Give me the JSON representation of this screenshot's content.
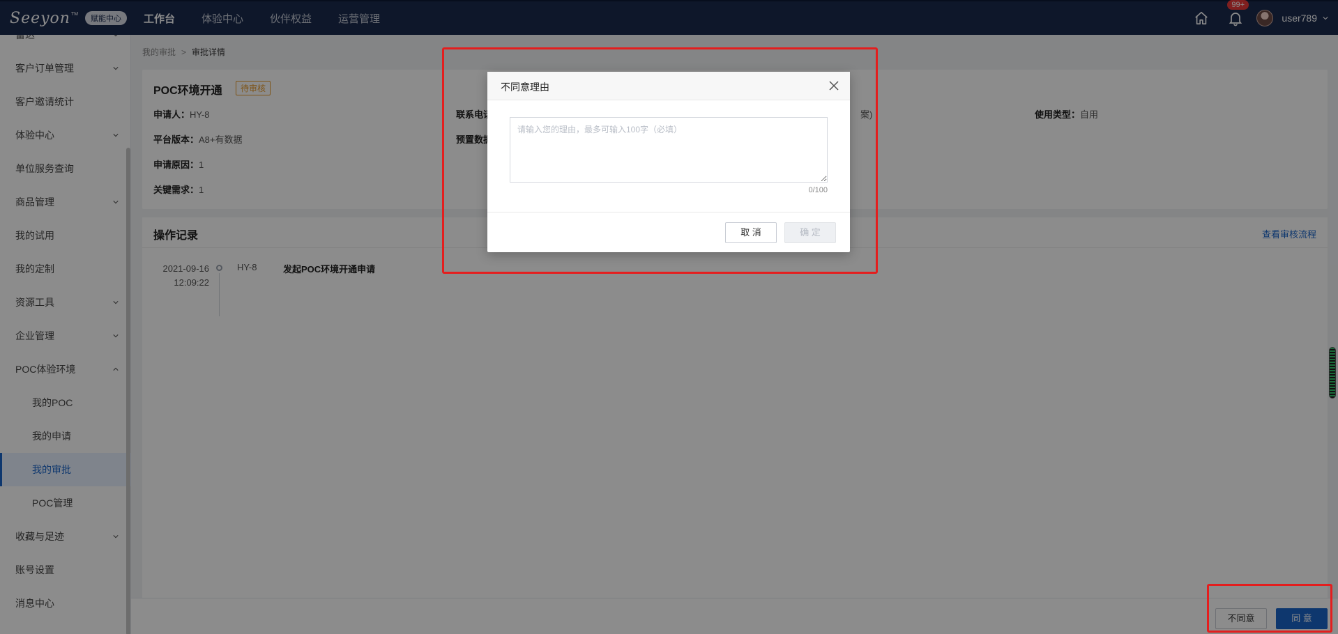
{
  "brand": {
    "logo_text": "Seeyon",
    "logo_tm": "TM",
    "badge": "赋能中心"
  },
  "nav": {
    "items": [
      "工作台",
      "体验中心",
      "伙伴权益",
      "运营管理"
    ]
  },
  "header": {
    "notification_count": "99+",
    "username": "user789"
  },
  "sidebar": {
    "items": [
      {
        "label": "雷达",
        "arrow": "down"
      },
      {
        "label": "客户订单管理",
        "arrow": "down"
      },
      {
        "label": "客户邀请统计"
      },
      {
        "label": "体验中心",
        "arrow": "down"
      },
      {
        "label": "单位服务查询"
      },
      {
        "label": "商品管理",
        "arrow": "down"
      },
      {
        "label": "我的试用"
      },
      {
        "label": "我的定制"
      },
      {
        "label": "资源工具",
        "arrow": "down"
      },
      {
        "label": "企业管理",
        "arrow": "down"
      },
      {
        "label": "POC体验环境",
        "arrow": "up"
      },
      {
        "label": "我的POC",
        "sub": true
      },
      {
        "label": "我的申请",
        "sub": true
      },
      {
        "label": "我的审批",
        "sub": true,
        "active": true
      },
      {
        "label": "POC管理",
        "sub": true
      },
      {
        "label": "收藏与足迹",
        "arrow": "down"
      },
      {
        "label": "账号设置"
      },
      {
        "label": "消息中心"
      }
    ]
  },
  "breadcrumb": {
    "parent": "我的审批",
    "sep": ">",
    "current": "审批详情"
  },
  "info": {
    "title": "POC环境开通",
    "status": "待审核",
    "applicant_label": "申请人：",
    "applicant": "HY-8",
    "phone_label": "联系电话：",
    "partial_text": "案)",
    "usage_label": "使用类型：",
    "usage": "自用",
    "platform_label": "平台版本：",
    "platform": "A8+有数据",
    "preset_label": "预置数据：",
    "reason_label": "申请原因：",
    "reason": "1",
    "key_label": "关键需求：",
    "key": "1"
  },
  "log": {
    "title": "操作记录",
    "link": "查看审核流程",
    "entries": [
      {
        "date": "2021-09-16",
        "time": "12:09:22",
        "user": "HY-8",
        "action": "发起POC环境开通申请"
      }
    ]
  },
  "footer": {
    "reject": "不同意",
    "approve": "同 意"
  },
  "dialog": {
    "title": "不同意理由",
    "placeholder": "请输入您的理由，最多可输入100字（必填）",
    "counter": "0/100",
    "cancel": "取 消",
    "confirm": "确 定"
  },
  "colors": {
    "nav_bg": "#1b2a4e",
    "primary": "#1a64c9",
    "pending": "#e59a2b",
    "highlight": "#e41e1e"
  }
}
